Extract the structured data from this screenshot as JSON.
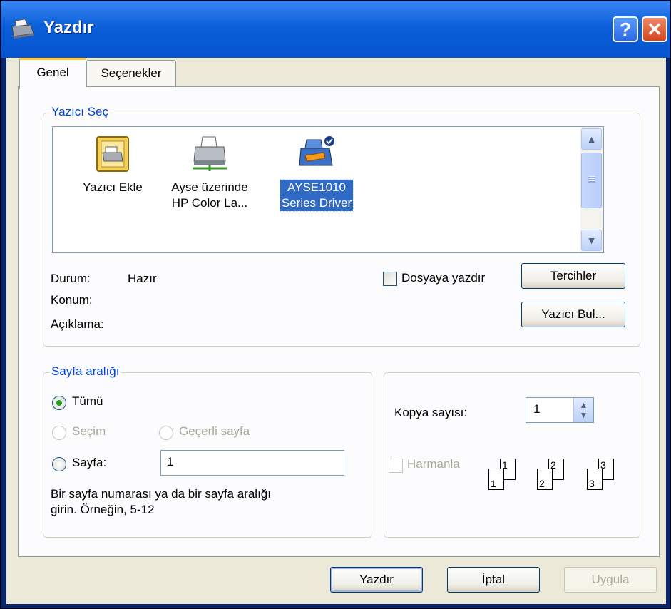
{
  "window": {
    "title": "Yazdır"
  },
  "tabs": [
    {
      "label": "Genel"
    },
    {
      "label": "Seçenekler"
    }
  ],
  "printer_group": {
    "legend": "Yazıcı Seç",
    "printers": [
      {
        "name": "Yazıcı Ekle"
      },
      {
        "name_line1": "Ayse üzerinde",
        "name_line2": "HP Color La..."
      },
      {
        "name_line1": "AYSE1010",
        "name_line2": "Series Driver",
        "selected": true
      }
    ],
    "status_label": "Durum:",
    "status_value": "Hazır",
    "location_label": "Konum:",
    "comment_label": "Açıklama:",
    "print_to_file": "Dosyaya yazdır",
    "preferences": "Tercihler",
    "find_printer": "Yazıcı Bul..."
  },
  "page_range": {
    "legend": "Sayfa aralığı",
    "all": "Tümü",
    "selection": "Seçim",
    "current_page": "Geçerli sayfa",
    "pages": "Sayfa:",
    "pages_value": "1",
    "hint_line1": "Bir sayfa numarası ya da bir sayfa aralığı",
    "hint_line2": "girin.  Örneğin, 5-12"
  },
  "copies": {
    "label": "Kopya sayısı:",
    "value": "1",
    "collate": "Harmanla",
    "page_numbers": [
      "1",
      "1",
      "2",
      "2",
      "3",
      "3"
    ]
  },
  "footer": {
    "print": "Yazdır",
    "cancel": "İptal",
    "apply": "Uygula"
  },
  "colors": {
    "title_bar": "#0a5fd8",
    "face": "#ece9d8",
    "selection": "#316ac5",
    "group_title": "#0046d5"
  }
}
